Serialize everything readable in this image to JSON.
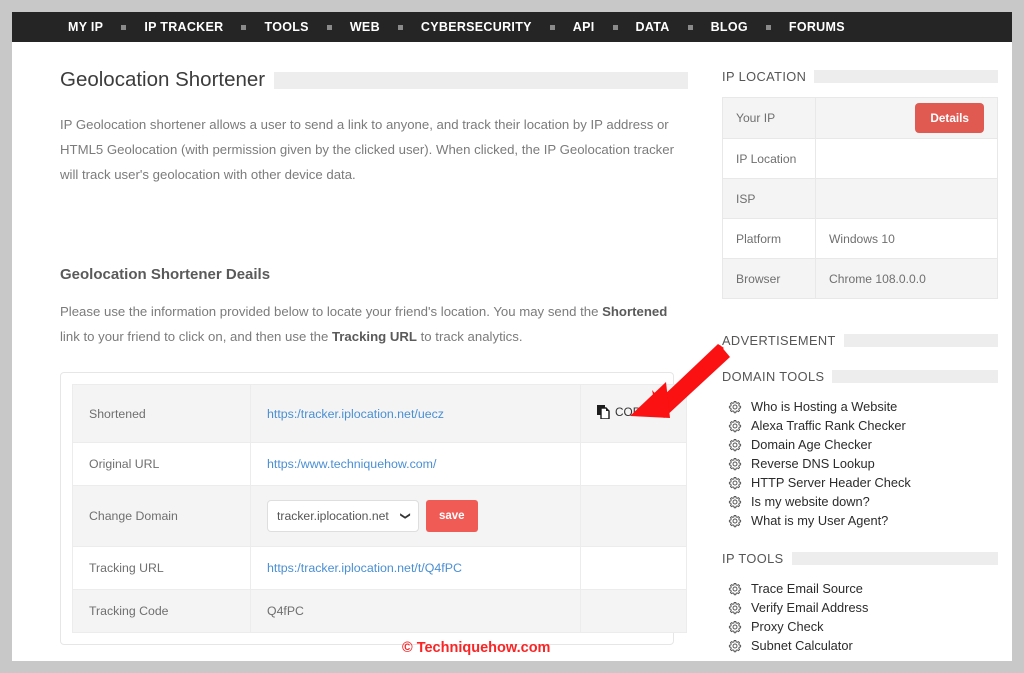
{
  "nav": {
    "items": [
      {
        "label": "MY IP"
      },
      {
        "label": "IP TRACKER"
      },
      {
        "label": "TOOLS"
      },
      {
        "label": "WEB"
      },
      {
        "label": "CYBERSECURITY"
      },
      {
        "label": "API"
      },
      {
        "label": "DATA"
      },
      {
        "label": "BLOG"
      },
      {
        "label": "FORUMS"
      }
    ]
  },
  "main": {
    "page_title": "Geolocation Shortener",
    "intro": "IP Geolocation shortener allows a user to send a link to anyone, and track their location by IP address or HTML5 Geolocation (with permission given by the clicked user). When clicked, the IP Geolocation tracker will track user's geolocation with other device data.",
    "details_title": "Geolocation Shortener Deails",
    "lead_part1": "Please use the information provided below to locate your friend's location. You may send the ",
    "lead_bold1": "Shortened",
    "lead_part2": " link to your friend to click on, and then use the ",
    "lead_bold2": "Tracking URL",
    "lead_part3": " to track analytics.",
    "table": {
      "rows": [
        {
          "label": "Shortened",
          "value": "https:/tracker.iplocation.net/uecz",
          "action": "COPY"
        },
        {
          "label": "Original URL",
          "value": "https:/www.techniquehow.com/",
          "action": ""
        },
        {
          "label": "Change Domain",
          "value": "",
          "action": ""
        },
        {
          "label": "Tracking URL",
          "value": "https:/tracker.iplocation.net/t/Q4fPC",
          "action": ""
        },
        {
          "label": "Tracking Code",
          "value": "Q4fPC",
          "action": ""
        }
      ]
    },
    "change_domain": {
      "selected": "tracker.iplocation.net",
      "options": [
        "tracker.iplocation.net"
      ],
      "save_label": "save"
    },
    "copy_label": "COPY",
    "watermark": "© Techniquehow.com"
  },
  "sidebar": {
    "ip_location": {
      "heading": "IP LOCATION",
      "rows": [
        {
          "key": "Your IP",
          "value": ""
        },
        {
          "key": "IP Location",
          "value": ""
        },
        {
          "key": "ISP",
          "value": ""
        },
        {
          "key": "Platform",
          "value": "Windows 10"
        },
        {
          "key": "Browser",
          "value": "Chrome 108.0.0.0"
        }
      ],
      "details_label": "Details"
    },
    "advertisement": {
      "heading": "ADVERTISEMENT"
    },
    "domain_tools": {
      "heading": "DOMAIN TOOLS",
      "items": [
        {
          "label": "Who is Hosting a Website"
        },
        {
          "label": "Alexa Traffic Rank Checker"
        },
        {
          "label": "Domain Age Checker"
        },
        {
          "label": "Reverse DNS Lookup"
        },
        {
          "label": "HTTP Server Header Check"
        },
        {
          "label": "Is my website down?"
        },
        {
          "label": "What is my User Agent?"
        }
      ]
    },
    "ip_tools": {
      "heading": "IP TOOLS",
      "items": [
        {
          "label": "Trace Email Source"
        },
        {
          "label": "Verify Email Address"
        },
        {
          "label": "Proxy Check"
        },
        {
          "label": "Subnet Calculator"
        }
      ]
    }
  },
  "colors": {
    "nav_bg": "#252525",
    "accent_red": "#f05b56",
    "details_red": "#e05a52",
    "link_blue": "#4a8fd4",
    "annotation_red": "#fb1111",
    "watermark_red": "#fb2424"
  }
}
